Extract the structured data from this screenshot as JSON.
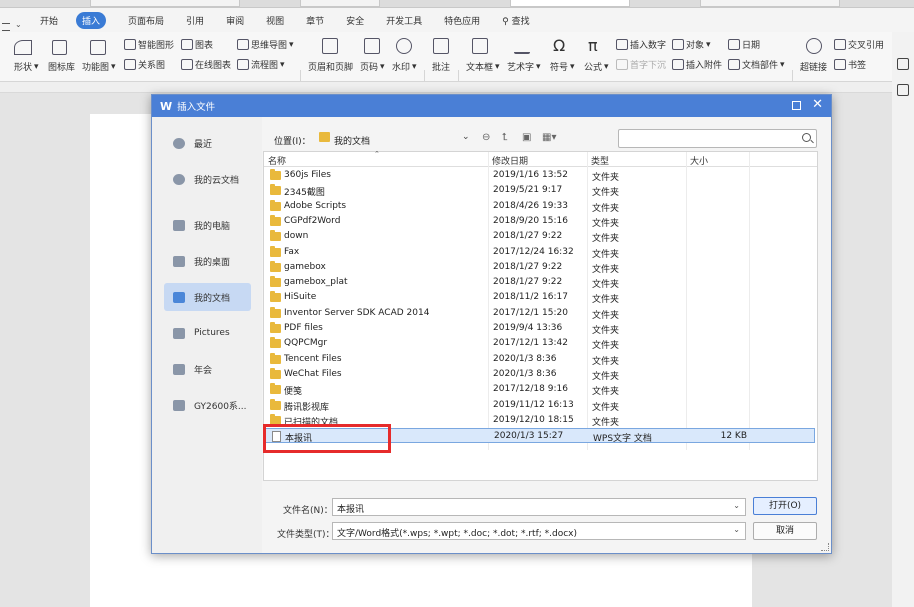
{
  "menu": {
    "items": [
      "开始",
      "插入",
      "页面布局",
      "引用",
      "审阅",
      "视图",
      "章节",
      "安全",
      "开发工具",
      "特色应用"
    ],
    "active": "插入",
    "search": "查找"
  },
  "ribbon": {
    "shapes": "形状",
    "icons": "图标库",
    "func_icons": "功能图",
    "smart_art": "智能图形",
    "chart": "图表",
    "mindmap": "思维导图",
    "relation": "关系图",
    "online_chart": "在线图表",
    "flow": "流程图",
    "header_footer": "页眉和页脚",
    "page_no": "页码",
    "watermark": "水印",
    "comment": "批注",
    "textbox": "文本框",
    "wordart": "艺术字",
    "symbol": "符号",
    "formula": "公式",
    "insert_number": "插入数字",
    "object": "对象",
    "dropcap": "首字下沉",
    "attachment": "插入附件",
    "date": "日期",
    "doc_parts": "文档部件",
    "crossref": "交叉引用",
    "hyperlink": "超链接",
    "bookmark": "书签"
  },
  "dialog": {
    "title": "插入文件",
    "logo": "W",
    "location_label": "位置(I)：",
    "location_value": "我的文档",
    "search_placeholder": "",
    "sidebar": [
      "最近",
      "我的云文档",
      "我的电脑",
      "我的桌面",
      "我的文档",
      "Pictures",
      "年会",
      "GY2600系..."
    ],
    "sidebar_selected": "我的文档",
    "columns": [
      "名称",
      "修改日期",
      "类型",
      "大小"
    ],
    "files": [
      {
        "name": "360js Files",
        "date": "2019/1/16 13:52",
        "type": "文件夹",
        "size": ""
      },
      {
        "name": "2345截图",
        "date": "2019/5/21 9:17",
        "type": "文件夹",
        "size": ""
      },
      {
        "name": "Adobe Scripts",
        "date": "2018/4/26 19:33",
        "type": "文件夹",
        "size": ""
      },
      {
        "name": "CGPdf2Word",
        "date": "2018/9/20 15:16",
        "type": "文件夹",
        "size": ""
      },
      {
        "name": "down",
        "date": "2018/1/27 9:22",
        "type": "文件夹",
        "size": ""
      },
      {
        "name": "Fax",
        "date": "2017/12/24 16:32",
        "type": "文件夹",
        "size": ""
      },
      {
        "name": "gamebox",
        "date": "2018/1/27 9:22",
        "type": "文件夹",
        "size": ""
      },
      {
        "name": "gamebox_plat",
        "date": "2018/1/27 9:22",
        "type": "文件夹",
        "size": ""
      },
      {
        "name": "HiSuite",
        "date": "2018/11/2 16:17",
        "type": "文件夹",
        "size": ""
      },
      {
        "name": "Inventor Server SDK ACAD 2014",
        "date": "2017/12/1 15:20",
        "type": "文件夹",
        "size": ""
      },
      {
        "name": "PDF files",
        "date": "2019/9/4 13:36",
        "type": "文件夹",
        "size": ""
      },
      {
        "name": "QQPCMgr",
        "date": "2017/12/1 13:42",
        "type": "文件夹",
        "size": ""
      },
      {
        "name": "Tencent Files",
        "date": "2020/1/3 8:36",
        "type": "文件夹",
        "size": ""
      },
      {
        "name": "WeChat Files",
        "date": "2020/1/3 8:36",
        "type": "文件夹",
        "size": ""
      },
      {
        "name": "便笺",
        "date": "2017/12/18 9:16",
        "type": "文件夹",
        "size": ""
      },
      {
        "name": "腾讯影视库",
        "date": "2019/11/12 16:13",
        "type": "文件夹",
        "size": ""
      },
      {
        "name": "已扫描的文档",
        "date": "2019/12/10 18:15",
        "type": "文件夹",
        "size": ""
      },
      {
        "name": "本报讯",
        "date": "2020/1/3 15:27",
        "type": "WPS文字 文档",
        "size": "12 KB"
      }
    ],
    "selected_file": "本报讯",
    "filename_label": "文件名(N)：",
    "filename_value": "本报讯",
    "filetype_label": "文件类型(T)：",
    "filetype_value": "文字/Word格式(*.wps; *.wpt; *.doc; *.dot; *.rtf; *.docx)",
    "open_button": "打开(O)",
    "cancel_button": "取消"
  },
  "colors": {
    "accent": "#4a7fd6",
    "highlight": "#e62b2b",
    "folder": "#e9b93c"
  }
}
